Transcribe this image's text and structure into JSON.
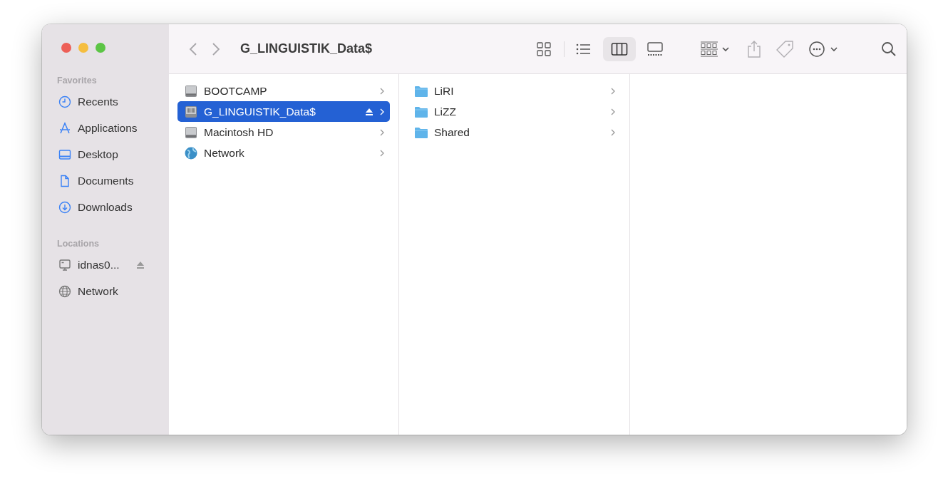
{
  "window": {
    "title": "G_LINGUISTIK_Data$"
  },
  "sidebar": {
    "sections": [
      {
        "heading": "Favorites",
        "items": [
          {
            "label": "Recents",
            "selected": false,
            "ejectable": false
          },
          {
            "label": "Applications",
            "selected": false,
            "ejectable": false
          },
          {
            "label": "Desktop",
            "selected": false,
            "ejectable": false
          },
          {
            "label": "Documents",
            "selected": false,
            "ejectable": false
          },
          {
            "label": "Downloads",
            "selected": false,
            "ejectable": false
          }
        ]
      },
      {
        "heading": "Locations",
        "items": [
          {
            "label": "idnas0...",
            "selected": false,
            "ejectable": true
          },
          {
            "label": "Network",
            "selected": false,
            "ejectable": false
          }
        ]
      }
    ]
  },
  "toolbar": {
    "view_buttons": [
      {
        "selected": false
      },
      {
        "selected": false
      },
      {
        "selected": true
      },
      {
        "selected": false
      }
    ]
  },
  "columns": [
    {
      "items": [
        {
          "label": "BOOTCAMP",
          "kind": "disk",
          "selected": false,
          "ejectable": false
        },
        {
          "label": "G_LINGUISTIK_Data$",
          "kind": "share",
          "selected": true,
          "ejectable": true
        },
        {
          "label": "Macintosh HD",
          "kind": "disk",
          "selected": false,
          "ejectable": false
        },
        {
          "label": "Network",
          "kind": "globe",
          "selected": false,
          "ejectable": false
        }
      ]
    },
    {
      "items": [
        {
          "label": "LiRI",
          "kind": "folder",
          "selected": false,
          "ejectable": false
        },
        {
          "label": "LiZZ",
          "kind": "folder",
          "selected": false,
          "ejectable": false
        },
        {
          "label": "Shared",
          "kind": "folder",
          "selected": false,
          "ejectable": false
        }
      ]
    }
  ]
}
